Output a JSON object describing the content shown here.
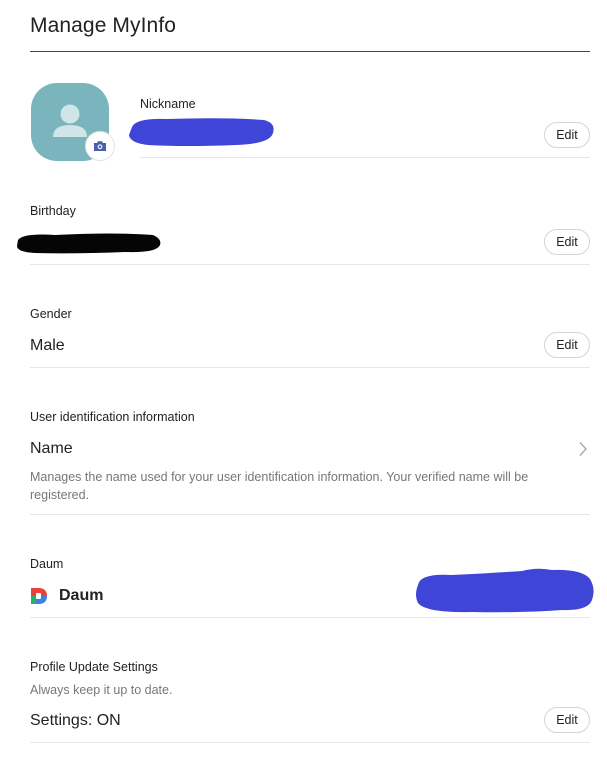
{
  "header": {
    "title": "Manage MyInfo"
  },
  "profile": {
    "nickname_label": "Nickname",
    "edit_label": "Edit",
    "avatar_icon": "person-icon",
    "camera_icon": "camera-icon",
    "avatar_color": "#7ab5bd",
    "camera_color": "#4a5fae"
  },
  "birthday": {
    "label": "Birthday",
    "edit_label": "Edit"
  },
  "gender": {
    "label": "Gender",
    "value": "Male",
    "edit_label": "Edit"
  },
  "user_identification": {
    "label": "User identification information",
    "value": "Name",
    "description": "Manages the name used for your user identification information. Your verified name will be registered.",
    "chevron_icon": "chevron-right-icon"
  },
  "daum": {
    "label": "Daum",
    "value": "Daum",
    "logo_icon": "daum-logo-icon"
  },
  "profile_update": {
    "label": "Profile Update Settings",
    "description": "Always keep it up to date.",
    "value": "Settings: ON",
    "edit_label": "Edit"
  },
  "redaction_colors": {
    "blue": "#3f45d6",
    "black": "#050505"
  }
}
